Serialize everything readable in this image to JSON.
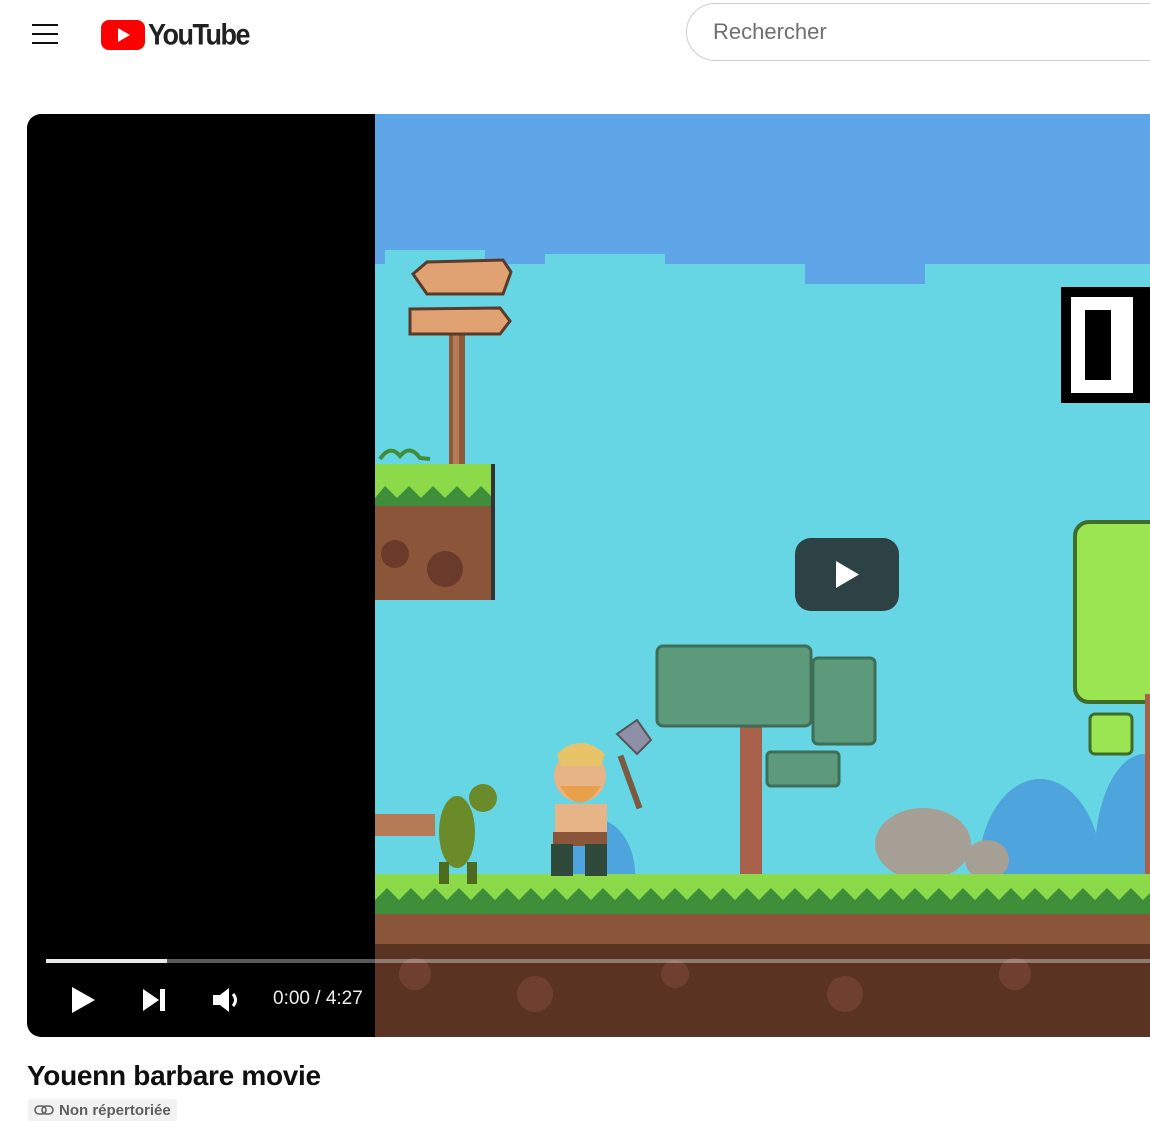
{
  "masthead": {
    "logo_text": "YouTube",
    "search": {
      "placeholder": "Rechercher",
      "value": ""
    },
    "icons": {
      "menu": "hamburger-menu-icon",
      "logo": "youtube-play-logo-icon"
    }
  },
  "player": {
    "current_time": "0:00",
    "duration": "4:27",
    "time_display": "0:00 / 4:27",
    "progress_fraction": 0.107,
    "icons": {
      "big_play": "play-icon",
      "play": "play-icon",
      "next": "skip-next-icon",
      "volume": "volume-icon"
    }
  },
  "video": {
    "title": "Youenn barbare movie",
    "visibility": "Non répertoriée",
    "visibility_icon": "link-icon"
  },
  "colors": {
    "brand_red": "#ff0000",
    "text": "#0f0f0f",
    "sky": "#5fa6e8",
    "grass": "#8cd94a"
  }
}
